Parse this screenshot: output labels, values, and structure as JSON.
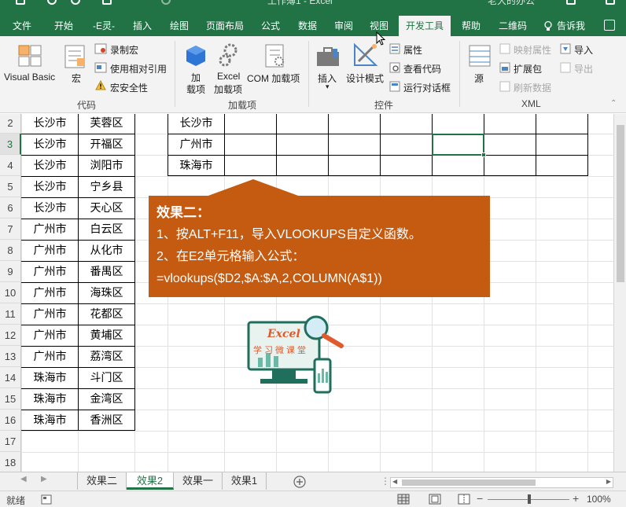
{
  "titlebar": {
    "title": "工作薄1 - Excel",
    "right_text": "",
    "user": "老大的办公"
  },
  "tabs": [
    {
      "label": "文件"
    },
    {
      "label": "开始"
    },
    {
      "label": "-E灵-"
    },
    {
      "label": "插入"
    },
    {
      "label": "绘图"
    },
    {
      "label": "页面布局"
    },
    {
      "label": "公式"
    },
    {
      "label": "数据"
    },
    {
      "label": "审阅"
    },
    {
      "label": "视图"
    },
    {
      "label": "开发工具"
    },
    {
      "label": "帮助"
    },
    {
      "label": "二维码"
    }
  ],
  "tell_me": "告诉我",
  "ribbon": {
    "code": {
      "label": "代码",
      "visual_basic": "Visual Basic",
      "macro": "宏",
      "record_macro": "录制宏",
      "relative_ref": "使用相对引用",
      "macro_security": "宏安全性"
    },
    "addins": {
      "label": "加载项",
      "addin_l1": "加",
      "addin_l2": "载项",
      "excel_addin_l1": "Excel",
      "excel_addin_l2": "加载项",
      "com_addin": "COM 加载项"
    },
    "controls": {
      "label": "控件",
      "insert": "插入",
      "design_mode": "设计模式",
      "properties": "属性",
      "view_code": "查看代码",
      "run_dialog": "运行对话框"
    },
    "xml": {
      "label": "XML",
      "source": "源",
      "map_properties": "映射属性",
      "expansion_packs": "扩展包",
      "refresh_data": "刷新数据",
      "import": "导入",
      "export": "导出"
    }
  },
  "sheet": {
    "row_numbers": [
      "2",
      "3",
      "4",
      "5",
      "6",
      "7",
      "8",
      "9",
      "10",
      "11",
      "12",
      "13",
      "14",
      "15",
      "16",
      "17",
      "18"
    ],
    "col_a": [
      "长沙市",
      "长沙市",
      "长沙市",
      "长沙市",
      "长沙市",
      "广州市",
      "广州市",
      "广州市",
      "广州市",
      "广州市",
      "广州市",
      "广州市",
      "珠海市",
      "珠海市",
      "珠海市"
    ],
    "col_b": [
      "芙蓉区",
      "开福区",
      "浏阳市",
      "宁乡县",
      "天心区",
      "白云区",
      "从化市",
      "番禺区",
      "海珠区",
      "花都区",
      "黄埔区",
      "荔湾区",
      "斗门区",
      "金湾区",
      "香洲区"
    ],
    "col_d": [
      "长沙市",
      "广州市",
      "珠海市"
    ]
  },
  "callout": {
    "title": "效果二：",
    "line1": "1、按ALT+F11，导入VLOOKUPS自定义函数。",
    "line2": "2、在E2单元格输入公式：",
    "line3": "=vlookups($D2,$A:$A,2,COLUMN(A$1))"
  },
  "logo": {
    "text1": "Excel",
    "text2": "学习微课堂"
  },
  "sheet_tabs": [
    {
      "label": "效果二"
    },
    {
      "label": "效果2"
    },
    {
      "label": "效果一"
    },
    {
      "label": "效果1"
    }
  ],
  "status": {
    "ready": "就绪",
    "zoom": "100%"
  },
  "colors": {
    "excel_green": "#217346",
    "callout_orange": "#c55a11"
  }
}
